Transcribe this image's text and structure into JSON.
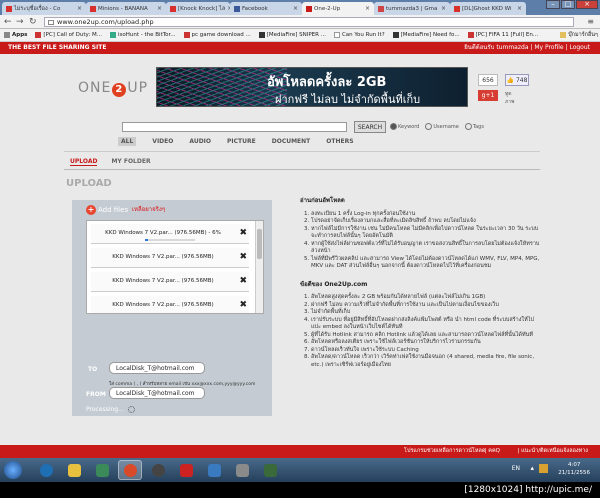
{
  "browser": {
    "tabs": [
      {
        "title": "ไม่ระบุชื่อเรื่อง - Co",
        "color": "#d7302a"
      },
      {
        "title": "Minions - BANANA",
        "color": "#d7302a"
      },
      {
        "title": "[Knock Knock] ไล",
        "color": "#d7302a"
      },
      {
        "title": "Facebook",
        "color": "#3b5998"
      },
      {
        "title": "One-2-Up",
        "color": "#c91a1a",
        "active": true
      },
      {
        "title": "tummazda3 | Gma",
        "color": "#c44"
      },
      {
        "title": "[DL]Ghost KKD Wi",
        "color": "#d7302a"
      }
    ],
    "url": "www.one2up.com/upload.php",
    "bookmarks": [
      {
        "label": "Apps",
        "color": "#888"
      },
      {
        "label": "[PC] Call of Duty: M...",
        "color": "#c33"
      },
      {
        "label": "isoHunt - the BitTor...",
        "color": "#3a8"
      },
      {
        "label": "pc game download ...",
        "color": "#c33"
      },
      {
        "label": "[MediaFire] SNIPER ...",
        "color": "#333"
      },
      {
        "label": "Can You Run It?",
        "color": "#fff"
      },
      {
        "label": "[MediaFire] Need fo...",
        "color": "#333"
      },
      {
        "label": "[PC] FIFA 11 [Full] En...",
        "color": "#c33"
      }
    ],
    "other_bookmarks": "บุ๊กมาร์กอื่นๆ"
  },
  "site": {
    "top_left": "THE BEST FILE SHARING SITE",
    "top_right": "ยินดีต้อนรับ tummazda | My Profile | Logout",
    "logo_left": "ONE",
    "logo_mid": "2",
    "logo_right": "UP",
    "banner_line1": "อัพโหลดครั้งละ 2GB",
    "banner_line2": "ฝากฟรี ไม่ลบ ไม่จำกัดพื้นที่เก็บ",
    "count": "656",
    "likes": "👍 748",
    "gplus": "g+1",
    "share": "ทูดภาพ",
    "search_button": "SEARCH",
    "radios": [
      "Keyword",
      "Username",
      "Tags"
    ],
    "categories": [
      "ALL",
      "VIDEO",
      "AUDIO",
      "PICTURE",
      "DOCUMENT",
      "OTHERS"
    ],
    "subtabs": [
      "UPLOAD",
      "MY FOLDER"
    ],
    "upload_title": "UPLOAD"
  },
  "upload": {
    "add_files": "Add files",
    "add_note": "เหลือยาจริงๆ",
    "files": [
      {
        "name": "KKD Windows 7 V2.par... (976.56MB) - 6%",
        "progress": 0.06
      },
      {
        "name": "KKD Windows 7 V2.par... (976.56MB)"
      },
      {
        "name": "KKD Windows 7 V2.par... (976.56MB)"
      },
      {
        "name": "KKD Windows 7 V2.par... (976.56MB)"
      }
    ],
    "to_label": "TO",
    "to_value": "LocalDisk_T@hotmail.com",
    "to_note": "ใส่ comma ( , ) สำหรับหลาย email เช่น xxx@xxx.com,yyy@yyy.com",
    "from_label": "FROM",
    "from_value": "LocalDisk_T@hotmail.com",
    "processing": "Processing..."
  },
  "rules": {
    "title": "อ่านก่อนอัพโหลด",
    "items": [
      "ลงทะเบียน 1 ครั้ง Log-in ทุกครั้งก่อนใช้งาน",
      "โปรดอย่าจัดเก็บเรื่องลามกและสื่อที่ละเมิดลิขสิทธิ์ ถ้าพบ ลบโดยไม่แจ้ง",
      "หากไฟล์ไม่มีการใช้งาน เช่น ไม่มีคนโหลด ไม่มีคลิกเพื่อไปดาวน์โหลด ในระยะเวลา 30 วัน ระบบจะทำการลบไฟล์นั้นๆ โดยอัตโนมัติ",
      "หากผู้ใช้ส่งไฟล์ผ่านซอฟต์แวร์ที่ไม่ได้รับอนุญาต เราขอสงวนสิทธิ์ในการลบโดยไม่ต้องแจ้งให้ทราบล่วงหน้า",
      "ไฟล์ที่มีพรีวิวผลคลิป และสามารถ View ได้โดยไม่ต้องดาวน์โหลดได้แก่ WMV, FLV, MP4, MPG, MKV และ DAT ส่วนไฟล์อื่นๆ นอกจากนี้ ต้องดาวน์โหลดไปไว้ที่เครื่องก่อนชม"
    ]
  },
  "about": {
    "title": "ข้อดีของ One2Up.com",
    "items": [
      "อัพโหลดสูงสุดครั้งละ 2 GB พร้อมกันได้หลายไฟล์ (แต่ละไฟล์ไม่เกิน 1GB)",
      "ฝากฟรี ไม่ลบ ความเร็วที่ไม่จำกัดพื้นที่การใช้งาน และเป็นไปตามเงื่อนไขของเว็บ",
      "ไม่จำกัดพื้นที่เก็บ",
      "เราปรับระบบ ที่อยู่มีสิทธิ์ที่อัปโหลดฝากส่งลิงค์แฟ้มโพสต์ หรือ นำ html code ที่ระบบสร้างให้ไปแปะ embed ลงในหน้าเว็บไซต์ได้ทันที",
      "ผู้ที่ได้รับ Hotlink สามารถ คลิก Hotlink แล้วดูได้เลย และสามารถดาวน์โหลดไฟล์ที่นั้นได้ทันที",
      "อัพโหลดหรือลงสเตียร เพราะใช้ไฟล์เวอร์ชันการให้บริการไวร่ามกรรมกัน",
      "ดาวน์โหลดเร็วทันใจ เพราะใช้ระบบ Caching",
      "อัพโหลด/ดาวน์โหลด เร็วกว่า เวิร์คท่าเฟสใช้งานมือจนอก (4 shared, media fire, file sonic, etc.) เพราะเซิร์ฟเวอร์อยู่เมืองไทย"
    ]
  },
  "footer": {
    "left": "โปรแกรมช่วยเหลือการดาวน์โหลด",
    "sep": "| คคQ",
    "right": "| แนะนำ/ติดเหนือแจ้งลองทาง"
  },
  "taskbar": {
    "apps": [
      {
        "color": "#1f6fb5"
      },
      {
        "color": "#e8c040"
      },
      {
        "color": "#3a8a5a"
      },
      {
        "color": "#d84a2a",
        "active": true
      },
      {
        "color": "#444"
      },
      {
        "color": "#c22"
      },
      {
        "color": "#3a7ac0"
      },
      {
        "color": "#8a8a8a"
      },
      {
        "color": "#3a6a3a"
      }
    ],
    "lang": "EN",
    "time": "4:07",
    "date": "21/11/2556"
  },
  "caption": "[1280x1024] http://upic.me/"
}
